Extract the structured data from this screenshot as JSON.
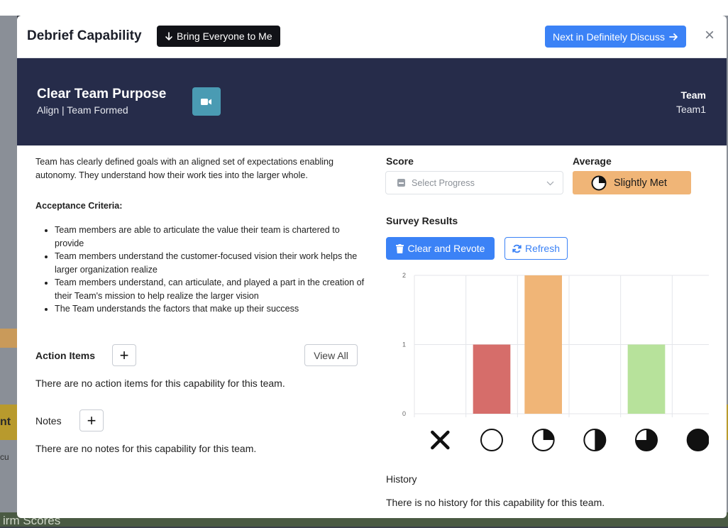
{
  "background": {
    "bottom_text": "irm Scores",
    "left_text": "nt",
    "left_text2": "cu"
  },
  "modal": {
    "title": "Debrief Capability",
    "bring_button": "Bring Everyone to Me",
    "next_button": "Next in Definitely Discuss",
    "close_glyph": "×"
  },
  "capability": {
    "name": "Clear Team Purpose",
    "subtitle": "Align | Team Formed",
    "team_label": "Team",
    "team_value": "Team1",
    "description": "Team has clearly defined goals with an aligned set of expectations enabling autonomy. They understand how their work ties into the larger whole.",
    "acceptance_title": "Acceptance Criteria:",
    "criteria": [
      "Team members are able to articulate the value their team is chartered to provide",
      "Team members understand the customer-focused vision their work helps the larger organization realize",
      "Team members understand, can articulate, and played a part in the creation of their Team's mission to help realize the larger vision",
      "The Team understands the factors that make up their success"
    ]
  },
  "action_items": {
    "title": "Action Items",
    "add_glyph": "+",
    "view_all": "View All",
    "empty": "There are no action items for this capability for this team."
  },
  "notes": {
    "title": "Notes",
    "add_glyph": "+",
    "empty": "There are no notes for this capability for this team."
  },
  "score": {
    "label": "Score",
    "placeholder": "Select Progress",
    "average_label": "Average",
    "average_value": "Slightly Met",
    "average_icon": "quarter-pie-icon",
    "average_color": "#f0b577"
  },
  "survey": {
    "title": "Survey Results",
    "clear_button": "Clear and Revote",
    "refresh_button": "Refresh"
  },
  "chart_data": {
    "type": "bar",
    "categories": [
      "Not applicable",
      "Not Met",
      "Slightly Met",
      "Half Met",
      "Mostly Met",
      "Fully Met"
    ],
    "category_icons": [
      "x-icon",
      "empty-circle-icon",
      "quarter-pie-icon",
      "half-circle-icon",
      "three-quarter-pie-icon",
      "full-circle-icon"
    ],
    "values": [
      0,
      1,
      2,
      0,
      1,
      0
    ],
    "colors": [
      "#d9d9d9",
      "#d66d6a",
      "#f0b577",
      "#999999",
      "#b7e29b",
      "#999999"
    ],
    "yticks": [
      "0",
      "1",
      "2"
    ],
    "ylim": [
      0,
      2
    ],
    "grid": true
  },
  "history": {
    "title": "History",
    "empty": "There is no history for this capability for this team."
  }
}
